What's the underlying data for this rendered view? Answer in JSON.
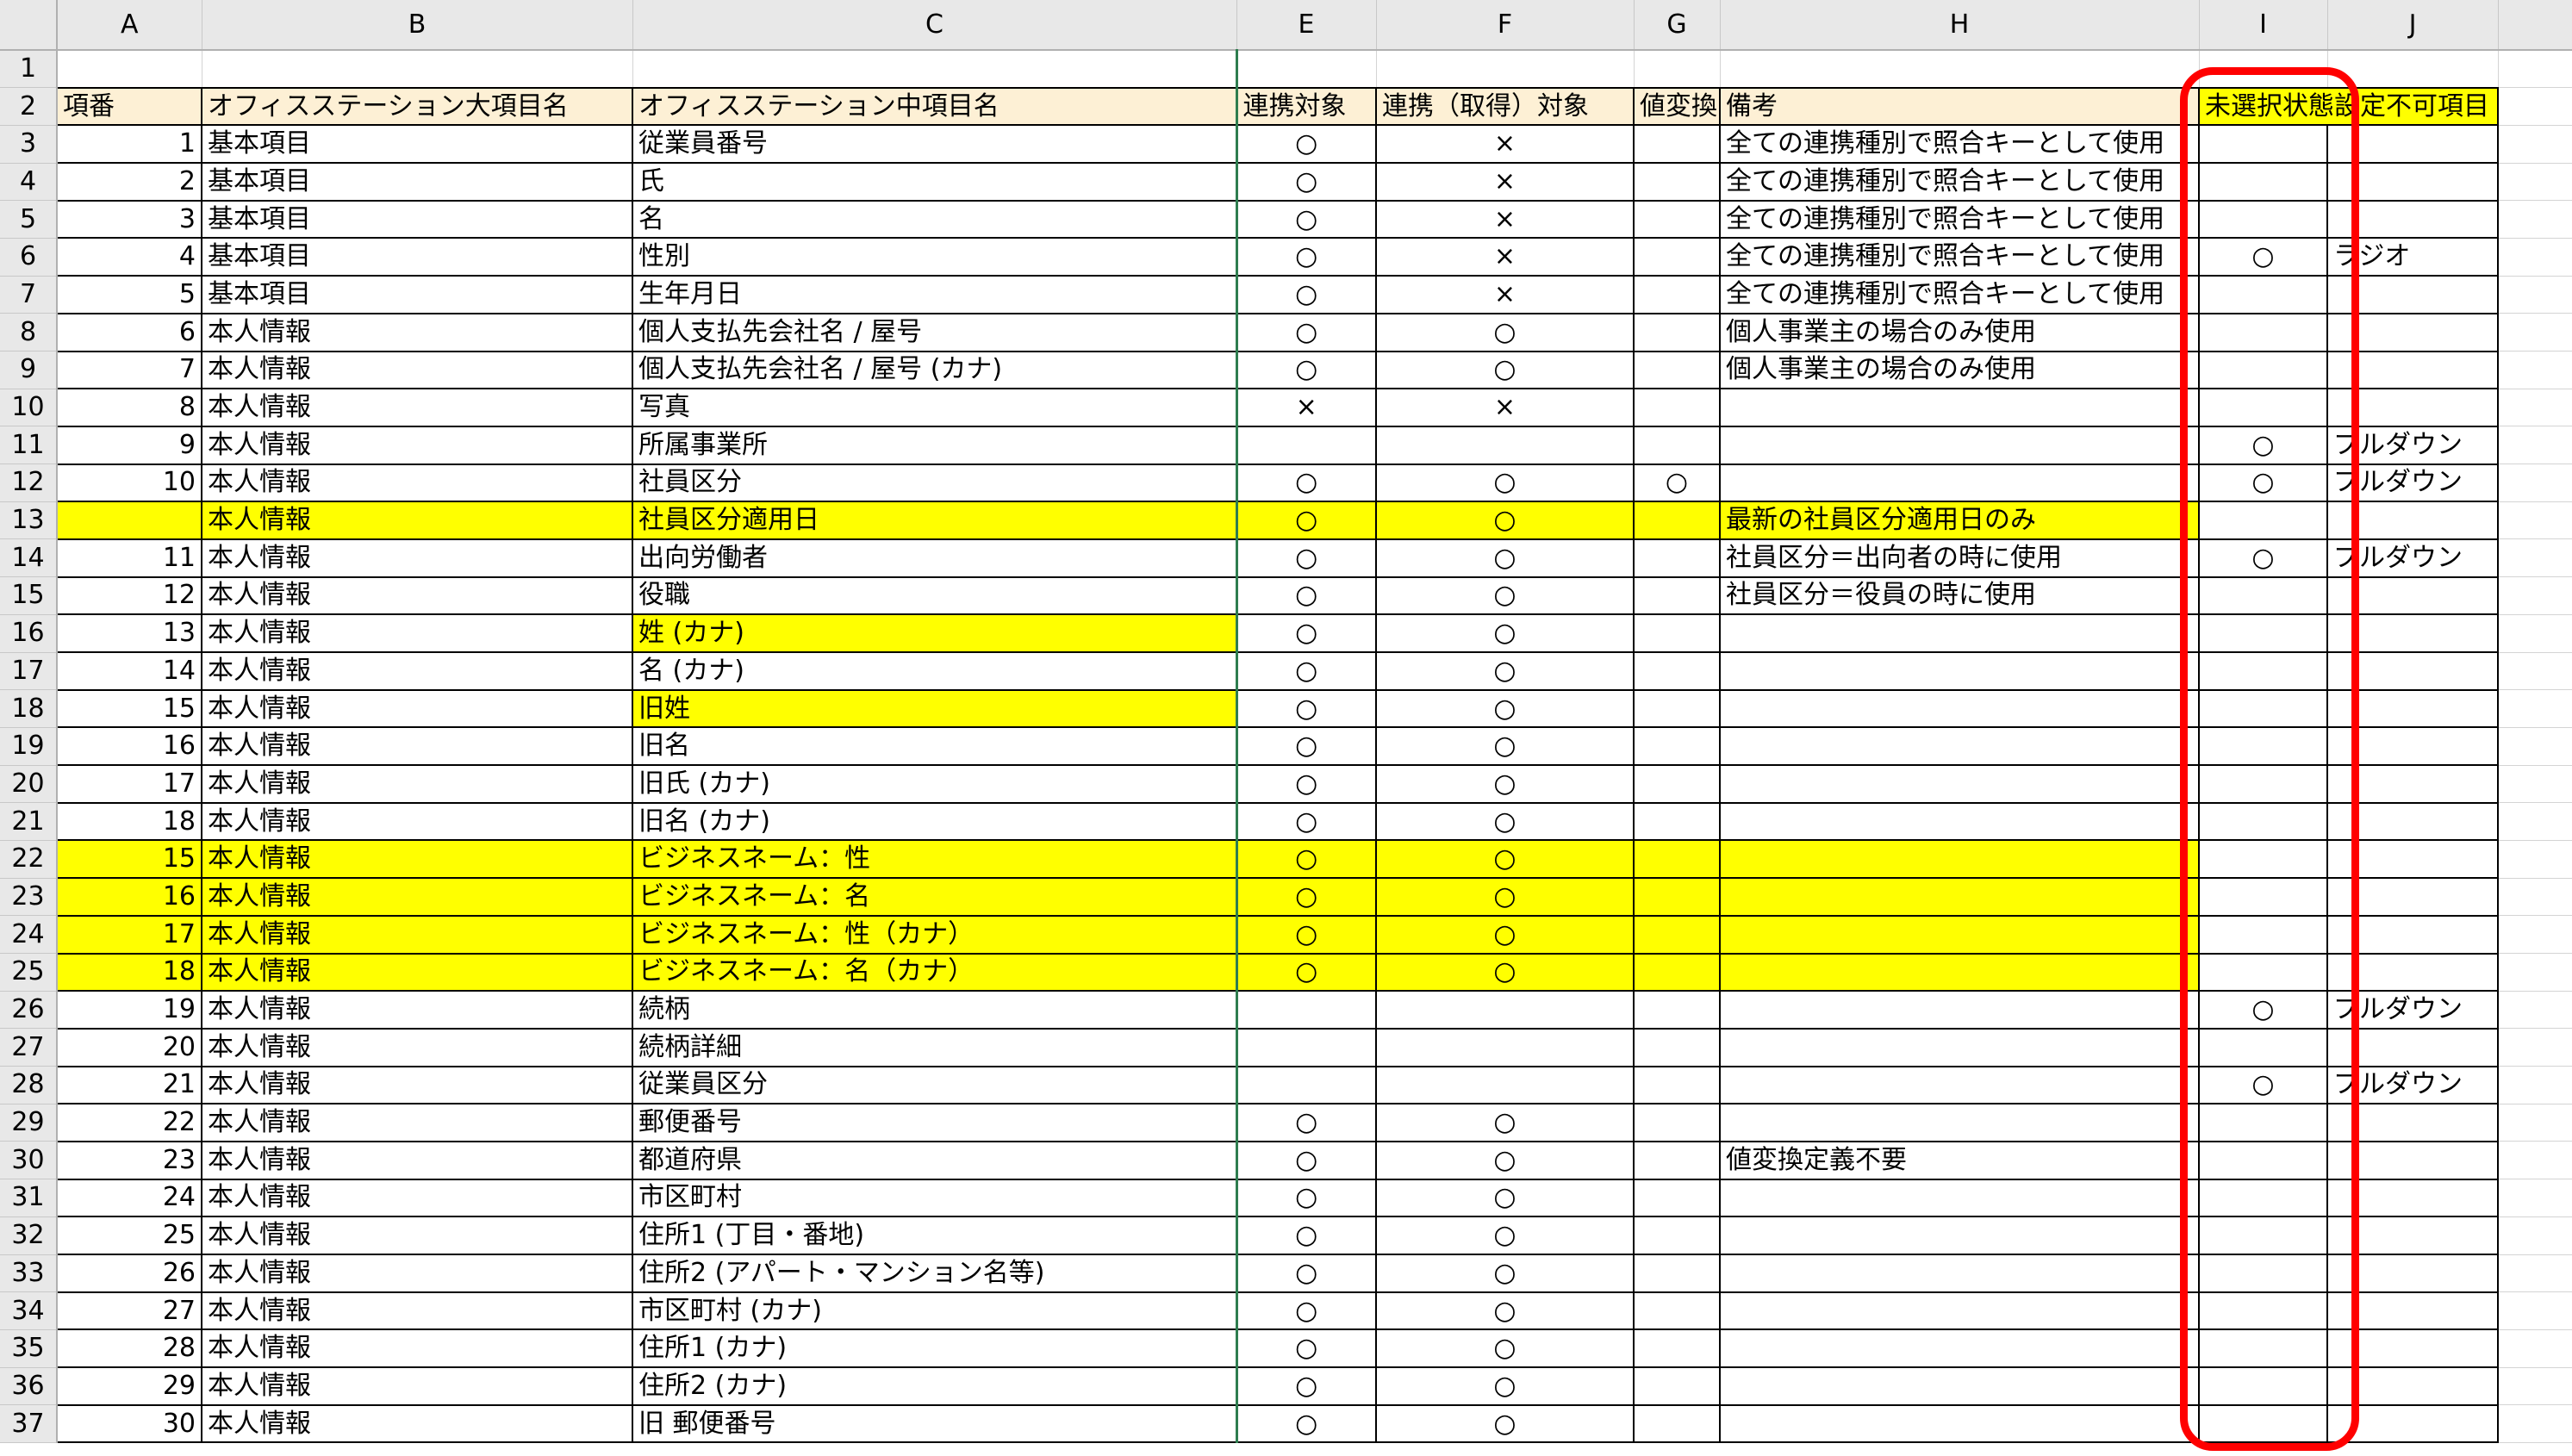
{
  "columns": [
    "A",
    "B",
    "C",
    "E",
    "F",
    "G",
    "H",
    "I",
    "J"
  ],
  "headers": {
    "no": "項番",
    "large": "オフィスステーション大項目名",
    "mid": "オフィスステーション中項目名",
    "link": "連携対象",
    "get": "連携（取得）対象",
    "conv": "値変換",
    "note": "備考",
    "unselected": "未選択状態設定不可項目"
  },
  "row_numbers": [
    "1",
    "2",
    "3",
    "4",
    "5",
    "6",
    "7",
    "8",
    "9",
    "10",
    "11",
    "12",
    "13",
    "14",
    "15",
    "16",
    "17",
    "18",
    "19",
    "20",
    "21",
    "22",
    "23",
    "24",
    "25",
    "26",
    "27",
    "28",
    "29",
    "30",
    "31",
    "32",
    "33",
    "34",
    "35",
    "36",
    "37"
  ],
  "rows": [
    {
      "no": "1",
      "large": "基本項目",
      "mid": "従業員番号",
      "link": "○",
      "get": "×",
      "conv": "",
      "note": "全ての連携種別で照合キーとして使用",
      "i": "",
      "j": ""
    },
    {
      "no": "2",
      "large": "基本項目",
      "mid": "氏",
      "link": "○",
      "get": "×",
      "conv": "",
      "note": "全ての連携種別で照合キーとして使用",
      "i": "",
      "j": ""
    },
    {
      "no": "3",
      "large": "基本項目",
      "mid": "名",
      "link": "○",
      "get": "×",
      "conv": "",
      "note": "全ての連携種別で照合キーとして使用",
      "i": "",
      "j": ""
    },
    {
      "no": "4",
      "large": "基本項目",
      "mid": "性別",
      "link": "○",
      "get": "×",
      "conv": "",
      "note": "全ての連携種別で照合キーとして使用",
      "i": "○",
      "j": "ラジオ"
    },
    {
      "no": "5",
      "large": "基本項目",
      "mid": "生年月日",
      "link": "○",
      "get": "×",
      "conv": "",
      "note": "全ての連携種別で照合キーとして使用",
      "i": "",
      "j": ""
    },
    {
      "no": "6",
      "large": "本人情報",
      "mid": "個人支払先会社名 / 屋号",
      "link": "○",
      "get": "○",
      "conv": "",
      "note": "個人事業主の場合のみ使用",
      "i": "",
      "j": ""
    },
    {
      "no": "7",
      "large": "本人情報",
      "mid": "個人支払先会社名 / 屋号 (カナ)",
      "link": "○",
      "get": "○",
      "conv": "",
      "note": "個人事業主の場合のみ使用",
      "i": "",
      "j": ""
    },
    {
      "no": "8",
      "large": "本人情報",
      "mid": "写真",
      "link": "×",
      "get": "×",
      "conv": "",
      "note": "",
      "i": "",
      "j": ""
    },
    {
      "no": "9",
      "large": "本人情報",
      "mid": "所属事業所",
      "link": "",
      "get": "",
      "conv": "",
      "note": "",
      "i": "○",
      "j": "プルダウン"
    },
    {
      "no": "10",
      "large": "本人情報",
      "mid": "社員区分",
      "link": "○",
      "get": "○",
      "conv": "○",
      "note": "",
      "i": "○",
      "j": "プルダウン"
    },
    {
      "no": "",
      "large": "本人情報",
      "mid": "社員区分適用日",
      "link": "○",
      "get": "○",
      "conv": "",
      "note": "最新の社員区分適用日のみ",
      "i": "",
      "j": "",
      "hl": "all"
    },
    {
      "no": "11",
      "large": "本人情報",
      "mid": "出向労働者",
      "link": "○",
      "get": "○",
      "conv": "",
      "note": "社員区分＝出向者の時に使用",
      "i": "○",
      "j": "プルダウン"
    },
    {
      "no": "12",
      "large": "本人情報",
      "mid": "役職",
      "link": "○",
      "get": "○",
      "conv": "",
      "note": "社員区分＝役員の時に使用",
      "i": "",
      "j": ""
    },
    {
      "no": "13",
      "large": "本人情報",
      "mid": "姓 (カナ)",
      "link": "○",
      "get": "○",
      "conv": "",
      "note": "",
      "i": "",
      "j": "",
      "hl": "mid"
    },
    {
      "no": "14",
      "large": "本人情報",
      "mid": "名 (カナ)",
      "link": "○",
      "get": "○",
      "conv": "",
      "note": "",
      "i": "",
      "j": ""
    },
    {
      "no": "15",
      "large": "本人情報",
      "mid": "旧姓",
      "link": "○",
      "get": "○",
      "conv": "",
      "note": "",
      "i": "",
      "j": "",
      "hl": "mid"
    },
    {
      "no": "16",
      "large": "本人情報",
      "mid": "旧名",
      "link": "○",
      "get": "○",
      "conv": "",
      "note": "",
      "i": "",
      "j": ""
    },
    {
      "no": "17",
      "large": "本人情報",
      "mid": "旧氏 (カナ)",
      "link": "○",
      "get": "○",
      "conv": "",
      "note": "",
      "i": "",
      "j": ""
    },
    {
      "no": "18",
      "large": "本人情報",
      "mid": "旧名 (カナ)",
      "link": "○",
      "get": "○",
      "conv": "",
      "note": "",
      "i": "",
      "j": ""
    },
    {
      "no": "15",
      "large": "本人情報",
      "mid": "ビジネスネーム：性",
      "link": "○",
      "get": "○",
      "conv": "",
      "note": "",
      "i": "",
      "j": "",
      "hl": "all"
    },
    {
      "no": "16",
      "large": "本人情報",
      "mid": "ビジネスネーム：名",
      "link": "○",
      "get": "○",
      "conv": "",
      "note": "",
      "i": "",
      "j": "",
      "hl": "all"
    },
    {
      "no": "17",
      "large": "本人情報",
      "mid": "ビジネスネーム：性（カナ）",
      "link": "○",
      "get": "○",
      "conv": "",
      "note": "",
      "i": "",
      "j": "",
      "hl": "all"
    },
    {
      "no": "18",
      "large": "本人情報",
      "mid": "ビジネスネーム：名（カナ）",
      "link": "○",
      "get": "○",
      "conv": "",
      "note": "",
      "i": "",
      "j": "",
      "hl": "all"
    },
    {
      "no": "19",
      "large": "本人情報",
      "mid": "続柄",
      "link": "",
      "get": "",
      "conv": "",
      "note": "",
      "i": "○",
      "j": "プルダウン"
    },
    {
      "no": "20",
      "large": "本人情報",
      "mid": "続柄詳細",
      "link": "",
      "get": "",
      "conv": "",
      "note": "",
      "i": "",
      "j": ""
    },
    {
      "no": "21",
      "large": "本人情報",
      "mid": "従業員区分",
      "link": "",
      "get": "",
      "conv": "",
      "note": "",
      "i": "○",
      "j": "プルダウン"
    },
    {
      "no": "22",
      "large": "本人情報",
      "mid": "郵便番号",
      "link": "○",
      "get": "○",
      "conv": "",
      "note": "",
      "i": "",
      "j": ""
    },
    {
      "no": "23",
      "large": "本人情報",
      "mid": "都道府県",
      "link": "○",
      "get": "○",
      "conv": "",
      "note": "値変換定義不要",
      "i": "",
      "j": ""
    },
    {
      "no": "24",
      "large": "本人情報",
      "mid": "市区町村",
      "link": "○",
      "get": "○",
      "conv": "",
      "note": "",
      "i": "",
      "j": ""
    },
    {
      "no": "25",
      "large": "本人情報",
      "mid": "住所1 (丁目・番地)",
      "link": "○",
      "get": "○",
      "conv": "",
      "note": "",
      "i": "",
      "j": ""
    },
    {
      "no": "26",
      "large": "本人情報",
      "mid": "住所2 (アパート・マンション名等)",
      "link": "○",
      "get": "○",
      "conv": "",
      "note": "",
      "i": "",
      "j": ""
    },
    {
      "no": "27",
      "large": "本人情報",
      "mid": "市区町村 (カナ)",
      "link": "○",
      "get": "○",
      "conv": "",
      "note": "",
      "i": "",
      "j": ""
    },
    {
      "no": "28",
      "large": "本人情報",
      "mid": "住所1 (カナ)",
      "link": "○",
      "get": "○",
      "conv": "",
      "note": "",
      "i": "",
      "j": ""
    },
    {
      "no": "29",
      "large": "本人情報",
      "mid": "住所2 (カナ)",
      "link": "○",
      "get": "○",
      "conv": "",
      "note": "",
      "i": "",
      "j": ""
    },
    {
      "no": "30",
      "large": "本人情報",
      "mid": "旧 郵便番号",
      "link": "○",
      "get": "○",
      "conv": "",
      "note": "",
      "i": "",
      "j": ""
    }
  ],
  "colors": {
    "header_fill": "#fdf0d5",
    "highlight_fill": "#ffff00",
    "row_number_text": "#1f6e43",
    "annotation_box": "#ff0000"
  }
}
